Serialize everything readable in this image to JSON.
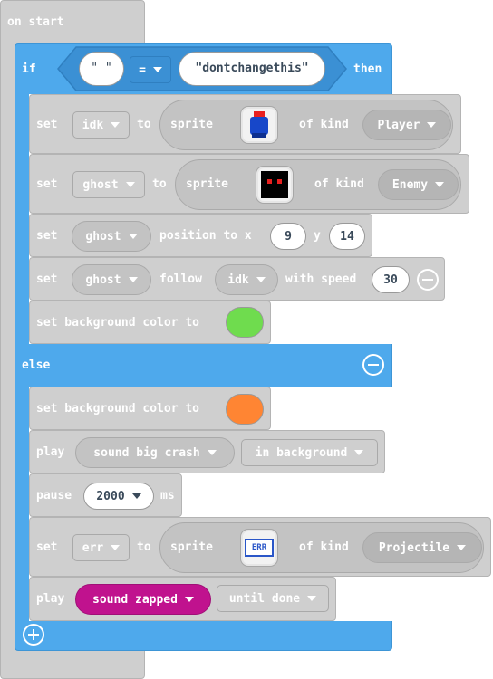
{
  "event": {
    "label": "on start"
  },
  "if_block": {
    "if_label": "if",
    "then_label": "then",
    "left_value": "\" \"",
    "operator": "=",
    "right_value": "\"dontchangethis\"",
    "else_label": "else"
  },
  "then_blocks": {
    "set_idk": {
      "set": "set",
      "var": "idk",
      "to": "to",
      "sprite": "sprite",
      "of_kind": "of kind",
      "kind": "Player",
      "sprite_icon": "blue-character-icon"
    },
    "set_ghost": {
      "set": "set",
      "var": "ghost",
      "to": "to",
      "sprite": "sprite",
      "of_kind": "of kind",
      "kind": "Enemy",
      "sprite_icon": "ghost-face-icon"
    },
    "set_position": {
      "set": "set",
      "var": "ghost",
      "position_to_x": "position to x",
      "x": "9",
      "y_label": "y",
      "y": "14"
    },
    "set_follow": {
      "set": "set",
      "var": "ghost",
      "follow": "follow",
      "target": "idk",
      "with_speed": "with speed",
      "speed": "30"
    },
    "set_bg": {
      "label": "set background color to",
      "color": "#6fdc4e"
    }
  },
  "else_blocks": {
    "set_bg": {
      "label": "set background color to",
      "color": "#ff8533"
    },
    "play_crash": {
      "play": "play",
      "sound": "sound big crash",
      "mode": "in background"
    },
    "pause": {
      "pause": "pause",
      "value": "2000",
      "unit": "ms"
    },
    "set_err": {
      "set": "set",
      "var": "err",
      "to": "to",
      "sprite": "sprite",
      "of_kind": "of kind",
      "kind": "Projectile",
      "sprite_icon": "err-sprite-icon",
      "sprite_text": "ERR"
    },
    "play_zapped": {
      "play": "play",
      "sound": "sound zapped",
      "mode": "until done"
    }
  },
  "colors": {
    "event_block": "#cfcfcf",
    "logic_block": "#4ea9ec",
    "sound_pill": "#c0128e"
  }
}
